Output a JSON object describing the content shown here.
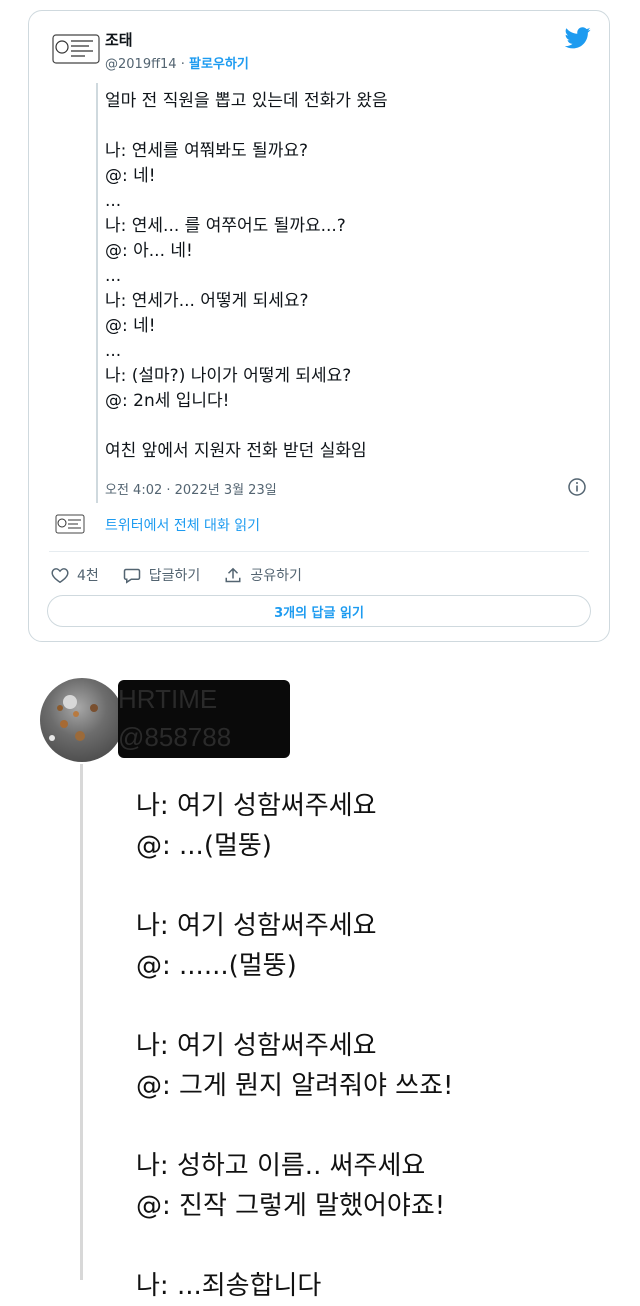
{
  "tweet": {
    "author_name": "조태",
    "author_handle": "@2019ff14",
    "separator": " · ",
    "follow_label": "팔로우하기",
    "body": "얼마 전 직원을 뽑고 있는데 전화가 왔음\n\n나: 연세를 여쭤봐도 될까요?\n@: 네!\n...\n나: 연세... 를 여쭈어도 될까요...?\n@: 아... 네!\n...\n나: 연세가... 어떻게 되세요?\n@: 네!\n...\n나: (설마?) 나이가 어떻게 되세요?\n@: 2n세 입니다!\n\n여친 앞에서 지원자 전화 받던 실화임",
    "timestamp": "오전 4:02 · 2022년 3월 23일",
    "conversation_link": "트위터에서 전체 대화 읽기",
    "likes": "4천",
    "reply_label": "답글하기",
    "share_label": "공유하기",
    "read_replies_label": "3개의 답글 읽기",
    "colors": {
      "accent": "#1d9bf0",
      "muted": "#536471",
      "border": "#cfd9de"
    },
    "icons": [
      "twitter-logo-icon",
      "info-icon",
      "heart-icon",
      "reply-bubble-icon",
      "share-icon"
    ]
  },
  "reply": {
    "redacted_name": "HRTIME",
    "redacted_handle": "@858788",
    "body": "나: 여기 성함써주세요\n@: ...(멀뚱)\n\n나: 여기 성함써주세요\n@: ......(멀뚱)\n\n나: 여기 성함써주세요\n@: 그게 뭔지 알려줘야 쓰죠!\n\n나: 성하고 이름.. 써주세요\n@: 진작 그렇게 말했어야죠!\n\n나: ...죄송합니다"
  }
}
